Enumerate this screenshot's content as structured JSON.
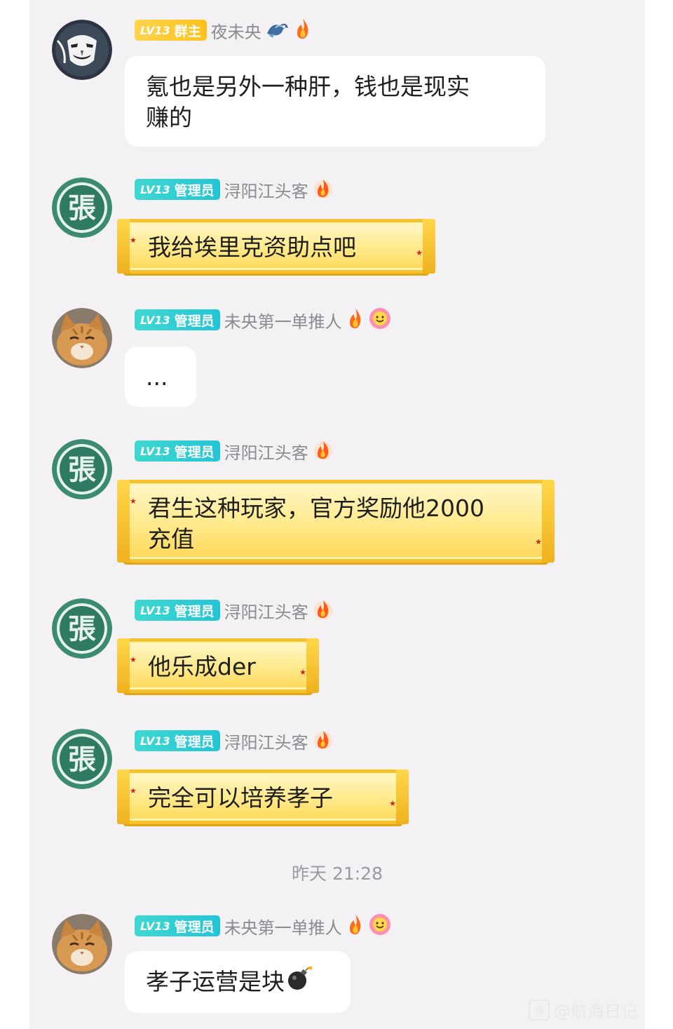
{
  "messages": [
    {
      "avatar": "mask-avatar",
      "badge": {
        "level": "LV13",
        "role": "群主",
        "type": "owner"
      },
      "nickname": "夜未央",
      "icons": [
        "dragon-icon",
        "fire-icon"
      ],
      "text": "氪也是另外一种肝，钱也是现实\n赚的",
      "style": "white"
    },
    {
      "avatar": "zhang-seal-avatar",
      "badge": {
        "level": "LV13",
        "role": "管理员",
        "type": "admin"
      },
      "nickname": "浔阳江头客",
      "icons": [
        "fire-icon"
      ],
      "text": "我给埃里克资助点吧",
      "style": "gold"
    },
    {
      "avatar": "cat-avatar",
      "badge": {
        "level": "LV13",
        "role": "管理员",
        "type": "admin"
      },
      "nickname": "未央第一单推人",
      "icons": [
        "fire-icon",
        "smile-flower-icon"
      ],
      "text": "...",
      "style": "white"
    },
    {
      "avatar": "zhang-seal-avatar",
      "badge": {
        "level": "LV13",
        "role": "管理员",
        "type": "admin"
      },
      "nickname": "浔阳江头客",
      "icons": [
        "fire-icon"
      ],
      "text": "君生这种玩家，官方奖励他2000\n充值",
      "style": "gold"
    },
    {
      "avatar": "zhang-seal-avatar",
      "badge": {
        "level": "LV13",
        "role": "管理员",
        "type": "admin"
      },
      "nickname": "浔阳江头客",
      "icons": [
        "fire-icon"
      ],
      "text": "他乐成der",
      "style": "gold"
    },
    {
      "avatar": "zhang-seal-avatar",
      "badge": {
        "level": "LV13",
        "role": "管理员",
        "type": "admin"
      },
      "nickname": "浔阳江头客",
      "icons": [
        "fire-icon"
      ],
      "text": "完全可以培养孝子",
      "style": "gold"
    },
    {
      "avatar": "cat-avatar",
      "badge": {
        "level": "LV13",
        "role": "管理员",
        "type": "admin"
      },
      "nickname": "未央第一单推人",
      "icons": [
        "fire-icon",
        "smile-flower-icon"
      ],
      "text": "孝子运营是块",
      "trailing_icon": "bomb-icon",
      "style": "white"
    }
  ],
  "timestamp": "昨天 21:28",
  "watermark": "@航海日记",
  "colors": {
    "background": "#f4f1f4",
    "owner_badge": "#ffc21a",
    "admin_badge": "#22c5d6",
    "gold_bubble": "#ffe98a",
    "nickname": "#8a8a8f"
  }
}
